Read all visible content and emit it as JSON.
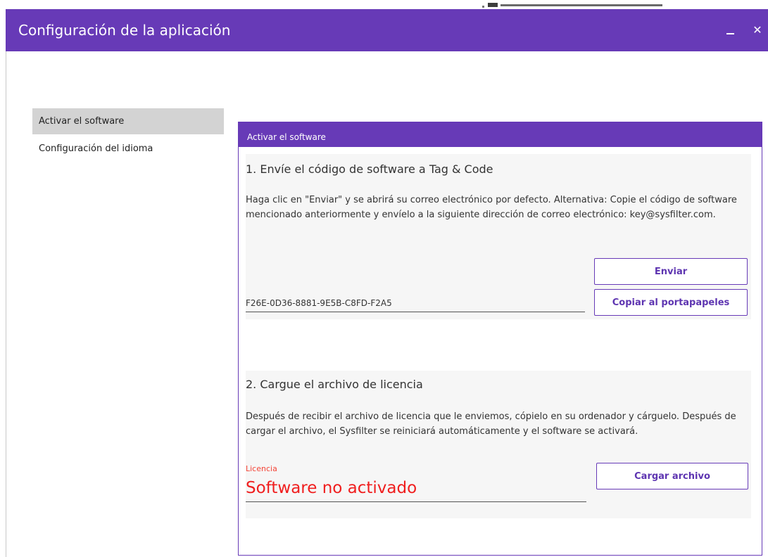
{
  "window": {
    "title": "Configuración de la aplicación",
    "minimize_icon": "minimize-icon",
    "close_icon": "close-icon",
    "close_glyph": "✕",
    "accent_color": "#673ab7"
  },
  "sidebar": {
    "items": [
      {
        "label": "Activar el software",
        "active": true
      },
      {
        "label": "Configuración del idioma",
        "active": false
      }
    ]
  },
  "panel": {
    "header": "Activar el software",
    "step1": {
      "title": "1. Envíe el código de software a Tag & Code",
      "description": "Haga clic en \"Enviar\" y se abrirá su correo electrónico por defecto. Alternativa: Copie el código de software mencionado anteriormente y envíelo a la siguiente dirección de correo electrónico: key@sysfilter.com.",
      "send_label": "Enviar",
      "software_code": "F26E-0D36-8881-9E5B-C8FD-F2A5",
      "copy_label": "Copiar al portapapeles"
    },
    "step2": {
      "title": "2. Cargue el archivo de licencia",
      "description": "Después de recibir el archivo de licencia que le enviemos, cópielo en su ordenador y cárguelo. Después de cargar el archivo, el Sysfilter se reiniciará automáticamente y el software se activará.",
      "license_label": "Licencia",
      "license_status": "Software no activado",
      "upload_label": "Cargar archivo",
      "status_color": "#f01e1e"
    }
  }
}
